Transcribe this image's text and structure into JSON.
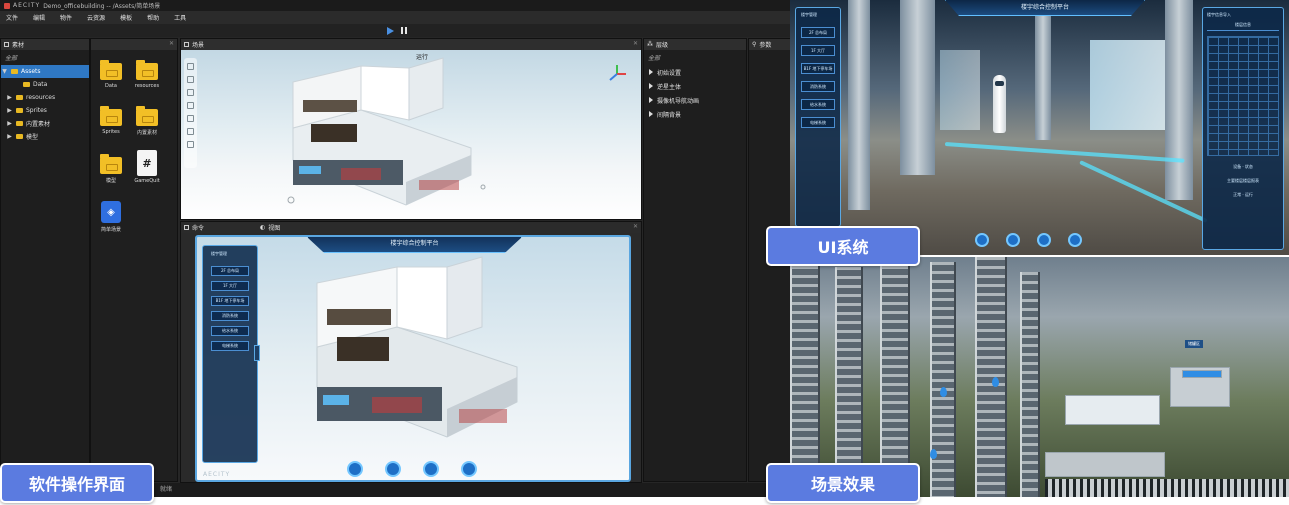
{
  "captions": {
    "software_ui": "软件操作界面",
    "ui_system": "UI系统",
    "scene_effect": "场景效果"
  },
  "colors": {
    "caption_bg": "#5b7be0",
    "editor_bg": "#262626",
    "selection": "#2f78c4",
    "folder": "#f2bf26",
    "hud_blue": "#5aa8e4"
  },
  "editor": {
    "logo_text": "AECITY",
    "title": "Demo_officebuilding -- /Assets/简单场景",
    "menu": [
      "文件",
      "编辑",
      "物件",
      "云资源",
      "模板",
      "帮助",
      "工具"
    ],
    "assets_panel": {
      "title": "素材",
      "all_label": "全部",
      "tree": [
        {
          "label": "Assets",
          "expanded": true,
          "selected": true
        },
        {
          "label": "Data",
          "expanded": false,
          "selected": false
        },
        {
          "label": "resources",
          "expanded": false,
          "selected": false
        },
        {
          "label": "Sprites",
          "expanded": false,
          "selected": false
        },
        {
          "label": "内置素材",
          "expanded": false,
          "selected": false
        },
        {
          "label": "模型",
          "expanded": false,
          "selected": false
        }
      ],
      "items": [
        {
          "label": "Data",
          "icon": "folder-icon"
        },
        {
          "label": "resources",
          "icon": "folder-icon"
        },
        {
          "label": "Sprites",
          "icon": "folder-icon"
        },
        {
          "label": "内置素材",
          "icon": "folder-icon"
        },
        {
          "label": "模型",
          "icon": "folder-icon"
        },
        {
          "label": "GameQuit",
          "icon": "script-file-icon",
          "glyph": "#"
        },
        {
          "label": "简单场景",
          "icon": "scene-file-icon"
        }
      ]
    },
    "scene_panel": {
      "title": "场景",
      "run_tab": "运行"
    },
    "command_panel": {
      "title": "命令",
      "view_tab": "视图"
    },
    "outline_panel": {
      "title": "层级",
      "all_label": "全部",
      "items": [
        "初始设置",
        "逆星主体",
        "摄像机导航动画",
        "间隔背景"
      ]
    },
    "props_panel": {
      "title": "参数"
    },
    "status": "就绪",
    "game_view": {
      "title": "楼宇综合控制平台",
      "sidebar_title": "楼宇管理",
      "buttons": [
        "2F 总布局",
        "1F 大厅",
        "B1F 地下停车场",
        "消防系统",
        "给水系统",
        "电梯系统"
      ],
      "watermark": "AECITY",
      "dock_icons": [
        "location-icon",
        "camera-icon",
        "battery-icon",
        "power-icon"
      ]
    }
  },
  "ui_shot": {
    "title": "楼宇综合控制平台",
    "sidebar_title": "楼宇管理",
    "buttons": [
      "2F 总布局",
      "1F 大厅",
      "B1F 地下停车场",
      "消防系统",
      "给水系统",
      "电梯系统"
    ],
    "right_title": "楼宇信息导入",
    "right_header": "楼层信息",
    "right_text_1": "设备 · 状态",
    "right_text_2": "主要楼层楼层报表",
    "right_text_3": "正常 · 运行",
    "dock_icons": [
      "location-icon",
      "camera-icon",
      "battery-icon",
      "power-icon"
    ]
  },
  "scene_shot": {
    "label": "储罐区"
  }
}
